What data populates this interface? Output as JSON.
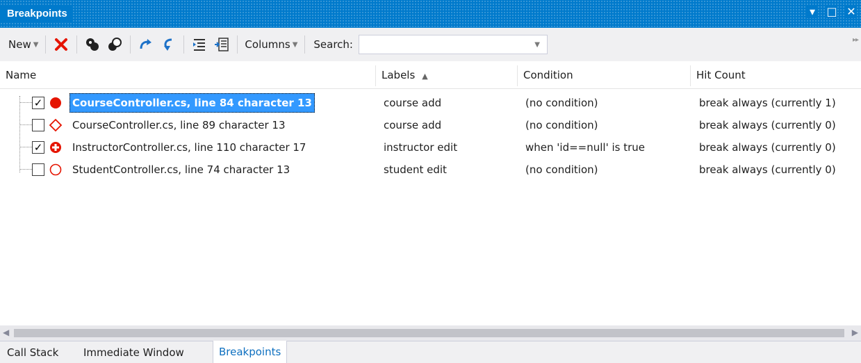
{
  "window": {
    "title": "Breakpoints",
    "controls": {
      "dropdown": "▾",
      "maximize": "□",
      "close": "✕"
    }
  },
  "toolbar": {
    "new_label": "New",
    "columns_label": "Columns",
    "search_label": "Search:",
    "search_value": "",
    "icons": [
      "delete-icon",
      "disable-all-icon",
      "enable-all-icon",
      "go-to-source-icon",
      "go-to-disassembly-icon",
      "export-icon",
      "import-icon"
    ]
  },
  "table": {
    "headers": {
      "name": "Name",
      "labels": "Labels",
      "condition": "Condition",
      "hit_count": "Hit Count"
    },
    "rows": [
      {
        "checked": "✓",
        "name": "CourseController.cs, line 84 character 13",
        "labels": "course add",
        "condition": "(no condition)",
        "hit_count": "break always (currently 1)"
      },
      {
        "checked": "",
        "name": "CourseController.cs, line 89 character 13",
        "labels": "course add",
        "condition": "(no condition)",
        "hit_count": "break always (currently 0)"
      },
      {
        "checked": "✓",
        "name": "InstructorController.cs, line 110 character 17",
        "labels": "instructor edit",
        "condition": "when 'id==null' is true",
        "hit_count": "break always (currently 0)"
      },
      {
        "checked": "",
        "name": "StudentController.cs, line 74 character 13",
        "labels": "student edit",
        "condition": "(no condition)",
        "hit_count": "break always (currently 0)"
      }
    ]
  },
  "bottom_tabs": {
    "call_stack": "Call Stack",
    "immediate": "Immediate Window",
    "breakpoints": "Breakpoints"
  },
  "colors": {
    "titlebar": "#007acc",
    "selection": "#3399ff",
    "breakpoint_red": "#e51400"
  }
}
